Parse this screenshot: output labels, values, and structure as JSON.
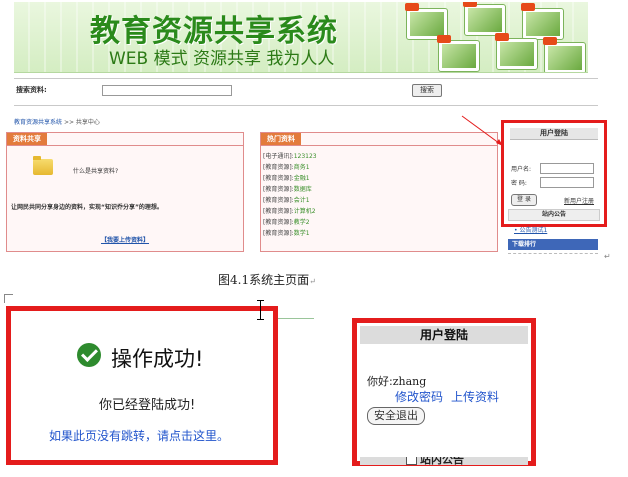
{
  "banner": {
    "title": "教育资源共享系统",
    "slogan": "WEB 模式 资源共享 我为人人"
  },
  "search": {
    "label": "搜索资料:",
    "button": "搜索",
    "value": ""
  },
  "breadcrumb": {
    "home": "教育资源共享系统",
    "sep": ">>",
    "current": "共享中心"
  },
  "left_panel": {
    "tab": "资料共享",
    "question": "什么是共享资料?",
    "description": "让网民共同分享身边的资料，实现“知识乔分享”的理想。",
    "upload_link": "【我要上传资料】"
  },
  "hot_panel": {
    "tab": "热门资料",
    "items": [
      {
        "category": "[电子通讯]:",
        "name": "123123"
      },
      {
        "category": "[教育资源]:",
        "name": "商务1"
      },
      {
        "category": "[教育资源]:",
        "name": "金融1"
      },
      {
        "category": "[教育资源]:",
        "name": "数据库"
      },
      {
        "category": "[教育资源]:",
        "name": "会计1"
      },
      {
        "category": "[教育资源]:",
        "name": "计算机2"
      },
      {
        "category": "[教育资源]:",
        "name": "教学2"
      },
      {
        "category": "[教育资源]:",
        "name": "数学1"
      }
    ]
  },
  "login_box": {
    "title": "用户登陆",
    "username_label": "用户名:",
    "password_label": "密  码:",
    "login_button": "登 录",
    "register_link": "新用户注册"
  },
  "side": {
    "announcement_title": "站内公告",
    "announcement_item": "• 公告测试1",
    "download_rank": "下载排行"
  },
  "caption": "图4.1系统主页面",
  "success_page": {
    "title": "操作成功!",
    "message": "你已经登陆成功!",
    "redirect": "如果此页没有跳转，请点击这里。"
  },
  "login_success": {
    "title": "用户登陆",
    "greeting": "你好:",
    "username": "zhang",
    "change_password": "修改密码",
    "upload": "上传资料",
    "logout_button": "安全退出",
    "footer": "站内公告"
  },
  "colors": {
    "highlight": "#e41c1c",
    "brand_green": "#2a8a1b",
    "link_blue": "#2255cc"
  }
}
